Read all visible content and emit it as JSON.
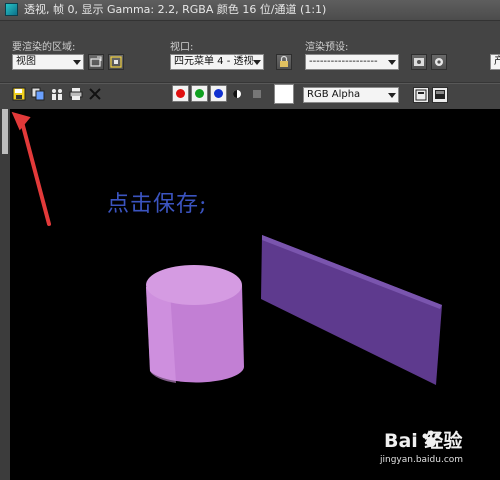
{
  "window": {
    "title": "透视, 帧 0, 显示 Gamma: 2.2, RGBA 颜色 16 位/通道 (1:1)"
  },
  "render_panel": {
    "area_label": "要渲染的区域:",
    "area_value": "视图",
    "viewport_label": "视口:",
    "viewport_value": "四元菜单 4 - 透视",
    "preset_label": "渲染预设:",
    "preset_value": "-------------------",
    "far_right_value": "产"
  },
  "frame_toolbar": {
    "channel_value": "RGB Alpha",
    "color_buttons": [
      "#e01010",
      "#10a020",
      "#1030d0"
    ]
  },
  "annotation": {
    "text": "点击保存;",
    "arrow_color": "#e23a3a"
  },
  "watermark": {
    "brand": "Bai  经验",
    "url": "jingyan.baidu.com"
  },
  "colors": {
    "cylinder": "#c98ad8",
    "plane": "#6a3f9a",
    "annotation_text": "#3b54c0",
    "viewport_bg": "#000000"
  }
}
